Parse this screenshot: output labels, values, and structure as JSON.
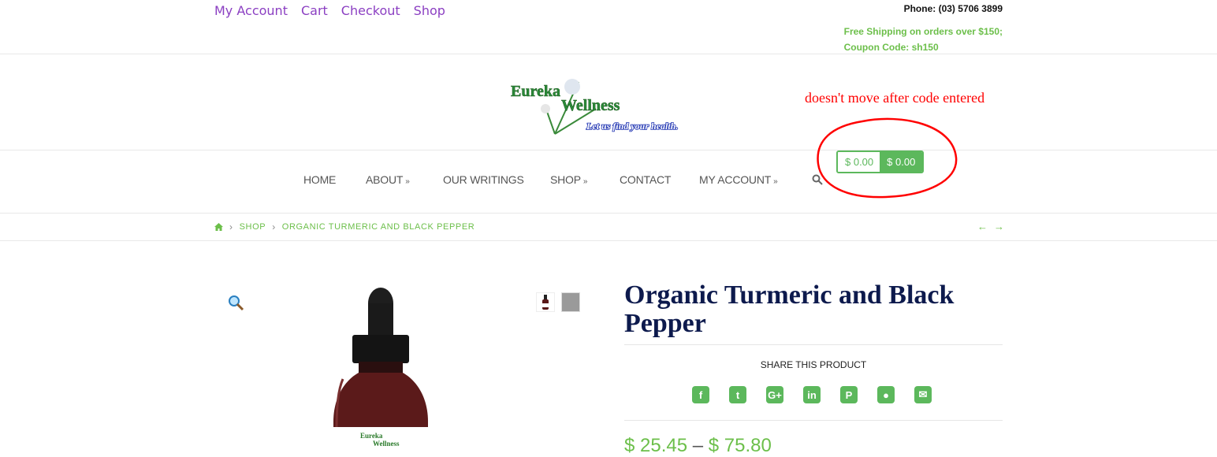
{
  "top_links": [
    "My Account",
    "Cart",
    "Checkout",
    "Shop"
  ],
  "phone": "Phone: (03) 5706 3899",
  "shipping_line1": "Free Shipping on orders over $150;",
  "shipping_line2": "Coupon Code: sh150",
  "logo": {
    "word1": "Eureka",
    "word2": "Wellness",
    "tagline": "Let us find your health."
  },
  "annotation": "doesn't move after code entered",
  "nav": [
    {
      "label": "HOME",
      "dropdown": false
    },
    {
      "label": "ABOUT",
      "dropdown": true
    },
    {
      "label": "OUR WRITINGS",
      "dropdown": false
    },
    {
      "label": "SHOP",
      "dropdown": true
    },
    {
      "label": "CONTACT",
      "dropdown": false
    },
    {
      "label": "MY ACCOUNT",
      "dropdown": true
    }
  ],
  "cart": {
    "total1": "$ 0.00",
    "total2": "$ 0.00"
  },
  "breadcrumb": [
    "SHOP",
    "ORGANIC TURMERIC AND BLACK PEPPER"
  ],
  "product": {
    "title": "Organic Turmeric and Black Pepper",
    "share_label": "SHARE THIS PRODUCT",
    "share_icons": [
      "facebook-icon",
      "twitter-icon",
      "google-plus-icon",
      "linkedin-icon",
      "pinterest-icon",
      "reddit-icon",
      "email-icon"
    ],
    "price_low": "$ 25.45",
    "price_sep": "–",
    "price_high": "$ 75.80",
    "label_word1": "Eureka",
    "label_word2": "Wellness"
  },
  "colors": {
    "accent": "#5cb85c",
    "link": "#8b3fc2",
    "title": "#0d1a4d",
    "annotation": "#ff0000"
  }
}
